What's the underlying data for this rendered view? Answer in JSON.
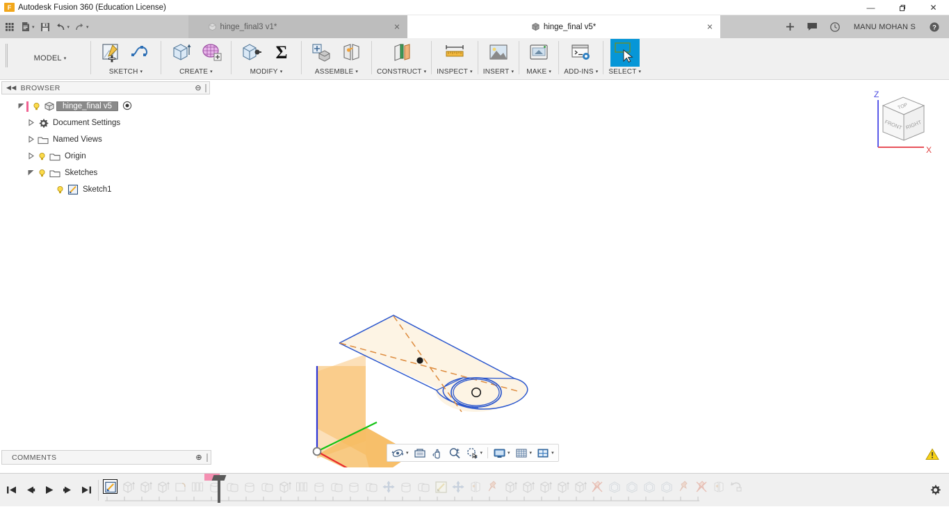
{
  "titlebar": {
    "app_title": "Autodesk Fusion 360 (Education License)",
    "logo_letter": "F",
    "minimize": "—",
    "restore": "❐",
    "close": "✕"
  },
  "quick_access": [
    {
      "name": "apps-grid-icon",
      "label": "",
      "caret": false
    },
    {
      "name": "new-file-icon",
      "label": "",
      "caret": true
    },
    {
      "name": "save-icon",
      "label": "",
      "caret": false
    },
    {
      "name": "undo-icon",
      "label": "",
      "caret": true
    },
    {
      "name": "redo-icon",
      "label": "",
      "caret": true
    }
  ],
  "tabs": [
    {
      "label": "hinge_final3 v1*",
      "active": false,
      "close": "✕"
    },
    {
      "label": "hinge_final v5*",
      "active": true,
      "close": "✕"
    }
  ],
  "tab_right": {
    "new_tab": "+",
    "comment_icon": "comment-icon",
    "job_status_icon": "job-status-icon",
    "username": "MANU MOHAN S",
    "help_icon": "help-icon"
  },
  "ribbon": {
    "workspace": {
      "label": "MODEL",
      "caret": "▾"
    },
    "groups": [
      {
        "label": "SKETCH",
        "caret": "▾",
        "buttons": [
          {
            "name": "create-sketch-icon"
          },
          {
            "name": "sketch-spline-icon"
          }
        ]
      },
      {
        "label": "CREATE",
        "caret": "▾",
        "buttons": [
          {
            "name": "extrude-icon"
          },
          {
            "name": "create-form-icon"
          }
        ]
      },
      {
        "label": "MODIFY",
        "caret": "▾",
        "buttons": [
          {
            "name": "press-pull-icon"
          },
          {
            "name": "change-parameters-icon"
          }
        ]
      },
      {
        "label": "ASSEMBLE",
        "caret": "▾",
        "buttons": [
          {
            "name": "new-component-icon"
          },
          {
            "name": "joint-icon"
          }
        ]
      },
      {
        "label": "CONSTRUCT",
        "caret": "▾",
        "buttons": [
          {
            "name": "offset-plane-icon"
          }
        ]
      },
      {
        "label": "INSPECT",
        "caret": "▾",
        "buttons": [
          {
            "name": "measure-icon"
          }
        ]
      },
      {
        "label": "INSERT",
        "caret": "▾",
        "buttons": [
          {
            "name": "insert-image-icon"
          }
        ]
      },
      {
        "label": "MAKE",
        "caret": "▾",
        "buttons": [
          {
            "name": "3d-print-icon"
          }
        ]
      },
      {
        "label": "ADD-INS",
        "caret": "▾",
        "buttons": [
          {
            "name": "scripts-addins-icon"
          }
        ]
      },
      {
        "label": "SELECT",
        "caret": "▾",
        "selected": true,
        "buttons": [
          {
            "name": "select-window-icon"
          }
        ]
      }
    ]
  },
  "browser": {
    "header": {
      "title": "BROWSER",
      "collapse": "◀◀",
      "minus": "⊖"
    },
    "tree": [
      {
        "label": "hinge_final v5",
        "depth": 0,
        "arrow": "open",
        "bulb": true,
        "icon": "component-icon",
        "root": true,
        "trailing": "radio-icon"
      },
      {
        "label": "Document Settings",
        "depth": 1,
        "arrow": "closed",
        "bulb": false,
        "icon": "gear-icon"
      },
      {
        "label": "Named Views",
        "depth": 1,
        "arrow": "closed",
        "bulb": false,
        "icon": "folder-icon"
      },
      {
        "label": "Origin",
        "depth": 1,
        "arrow": "closed",
        "bulb": true,
        "icon": "folder-icon"
      },
      {
        "label": "Sketches",
        "depth": 1,
        "arrow": "open",
        "bulb": true,
        "icon": "folder-icon"
      },
      {
        "label": "Sketch1",
        "depth": 2,
        "arrow": "none",
        "bulb": true,
        "icon": "sketch-icon"
      }
    ]
  },
  "viewcube": {
    "faces": {
      "top": "TOP",
      "front": "FRONT",
      "right": "RIGHT"
    },
    "axes": {
      "z": "Z",
      "x": "X"
    }
  },
  "navbar": [
    {
      "name": "orbit-icon",
      "caret": true
    },
    {
      "name": "look-at-icon",
      "caret": false
    },
    {
      "name": "pan-icon",
      "caret": false
    },
    {
      "name": "zoom-icon",
      "caret": false
    },
    {
      "name": "zoom-window-icon",
      "caret": true
    },
    {
      "name": "display-settings-icon",
      "caret": true
    },
    {
      "name": "grid-snaps-icon",
      "caret": true
    },
    {
      "name": "viewports-icon",
      "caret": true
    }
  ],
  "comments": {
    "label": "COMMENTS",
    "plus": "⊕"
  },
  "status": {
    "warning_icon": "warning-icon",
    "warning_glyph": "!"
  },
  "timeline": {
    "playback": [
      {
        "name": "go-to-beginning-icon",
        "glyph": "⏮"
      },
      {
        "name": "step-back-icon",
        "glyph": "⏴"
      },
      {
        "name": "play-icon",
        "glyph": "⏵"
      },
      {
        "name": "step-forward-icon",
        "glyph": "⏵"
      },
      {
        "name": "go-to-end-icon",
        "glyph": "⏭"
      }
    ],
    "settings_icon": "timeline-settings-icon",
    "features": [
      {
        "name": "sketch-feature",
        "icon": "sketch",
        "active": true
      },
      {
        "name": "extrude-feature",
        "icon": "extrude",
        "active": false
      },
      {
        "name": "extrude-feature",
        "icon": "extrude",
        "active": false
      },
      {
        "name": "extrude-feature",
        "icon": "extrude",
        "active": false
      },
      {
        "name": "fillet-feature",
        "icon": "fillet",
        "active": false
      },
      {
        "name": "pattern-feature",
        "icon": "pattern",
        "active": false
      },
      {
        "name": "body-feature",
        "icon": "body",
        "active": false
      },
      {
        "name": "combine-feature",
        "icon": "combine",
        "active": false
      },
      {
        "name": "body-feature",
        "icon": "body",
        "active": false
      },
      {
        "name": "combine-feature",
        "icon": "combine",
        "active": false
      },
      {
        "name": "extrude-feature",
        "icon": "extrude",
        "active": false
      },
      {
        "name": "pattern-feature",
        "icon": "pattern",
        "active": false
      },
      {
        "name": "body-feature",
        "icon": "body",
        "active": false
      },
      {
        "name": "combine-feature",
        "icon": "combine",
        "active": false
      },
      {
        "name": "body-feature",
        "icon": "body",
        "active": false
      },
      {
        "name": "combine-feature",
        "icon": "combine",
        "active": false
      },
      {
        "name": "move-feature",
        "icon": "move",
        "active": false
      },
      {
        "name": "body-feature",
        "icon": "body",
        "active": false
      },
      {
        "name": "combine-feature",
        "icon": "combine",
        "active": false
      },
      {
        "name": "sketch-feature",
        "icon": "sketch2",
        "active": false
      },
      {
        "name": "move-feature",
        "icon": "move",
        "active": false
      },
      {
        "name": "joint-feature",
        "icon": "joint",
        "active": false
      },
      {
        "name": "as-built-joint-feature",
        "icon": "pin",
        "active": false
      },
      {
        "name": "extrude-feature",
        "icon": "extrude",
        "active": false
      },
      {
        "name": "extrude-feature",
        "icon": "extrude",
        "active": false
      },
      {
        "name": "extrude-feature",
        "icon": "extrude",
        "active": false
      },
      {
        "name": "extrude-feature",
        "icon": "extrude",
        "active": false
      },
      {
        "name": "extrude-feature",
        "icon": "extrude",
        "active": false
      },
      {
        "name": "rigid-group-feature",
        "icon": "pinx",
        "active": false
      },
      {
        "name": "shell-feature",
        "icon": "shell",
        "active": false
      },
      {
        "name": "shell-feature",
        "icon": "shell",
        "active": false
      },
      {
        "name": "shell-feature",
        "icon": "shell",
        "active": false
      },
      {
        "name": "shell-feature",
        "icon": "shell",
        "active": false
      },
      {
        "name": "as-built-joint-feature",
        "icon": "pin",
        "active": false
      },
      {
        "name": "rigid-group-feature",
        "icon": "pinx",
        "active": false
      },
      {
        "name": "joint-feature",
        "icon": "joint",
        "active": false
      },
      {
        "name": "revert-feature",
        "icon": "revert",
        "active": false
      }
    ]
  },
  "viewport": {
    "sketch_name": "Sketch1",
    "colors": {
      "sketch_line": "#2255cc",
      "sketch_fill": "#fdf3e2",
      "construction_line": "#d98536",
      "origin_plane": "#f7b857",
      "axis_x": "#e8282d",
      "axis_y": "#12c312",
      "axis_z": "#2b35d6"
    }
  }
}
